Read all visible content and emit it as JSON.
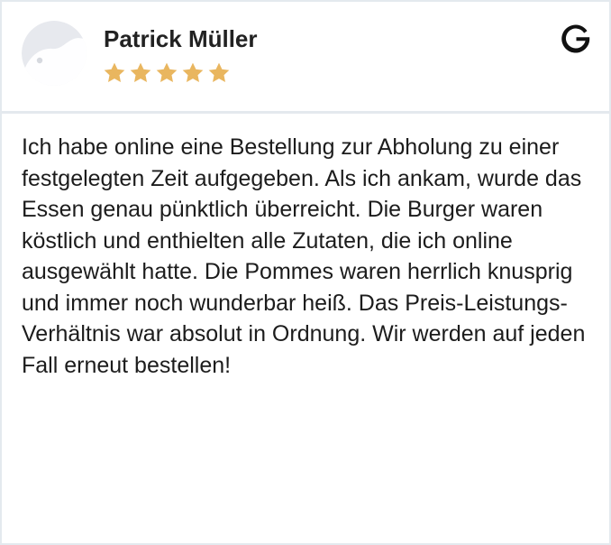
{
  "review": {
    "author_name": "Patrick Müller",
    "rating": 5,
    "rating_max": 5,
    "star_color": "#e9b65f",
    "source_icon": "google-icon",
    "text": "Ich habe online eine Bestellung zur Abholung zu einer festgelegten Zeit aufgegeben. Als ich ankam, wurde das Essen genau pünktlich überreicht. Die Burger waren köstlich und enthielten alle Zutaten, die ich online ausgewählt hatte. Die Pommes waren herrlich knusprig und immer noch wunderbar heiß. Das Preis-Leistungs-Verhältnis war absolut in Ordnung. Wir werden auf jeden Fall erneut bestellen!"
  },
  "colors": {
    "border": "#e4e9ee",
    "text": "#1c1c1c",
    "name": "#222222",
    "avatar_bg": "#e7e9ee"
  }
}
